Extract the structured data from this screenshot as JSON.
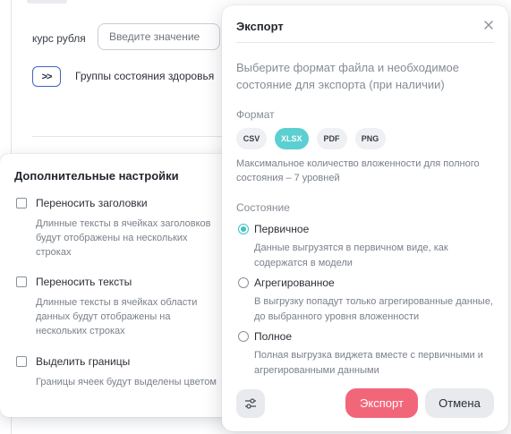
{
  "background": {
    "rate_label": "курс рубля",
    "rate_placeholder": "Введите значение",
    "expand_symbol": ">>",
    "health_groups_label": "Группы состояния здоровья"
  },
  "settings_panel": {
    "title": "Дополнительные настройки",
    "options": [
      {
        "label": "Переносить заголовки",
        "description": "Длинные тексты в ячейках заголовков будут отображены на нескольких строках",
        "checked": false
      },
      {
        "label": "Переносить тексты",
        "description": "Длинные тексты в ячейках области данных будут отображены на нескольких строках",
        "checked": false
      },
      {
        "label": "Выделить границы",
        "description": "Границы ячеек будут выделены цветом",
        "checked": false
      }
    ]
  },
  "export_dialog": {
    "title": "Экспорт",
    "close_icon": "close-icon",
    "intro": "Выберите формат файла и необходимое состояние для экспорта (при наличии)",
    "format_label": "Формат",
    "formats": [
      {
        "label": "CSV",
        "selected": false
      },
      {
        "label": "XLSX",
        "selected": true
      },
      {
        "label": "PDF",
        "selected": false
      },
      {
        "label": "PNG",
        "selected": false
      }
    ],
    "max_nesting_note": "Максимальное количество вложенности для полного состояния – 7 уровней",
    "state_label": "Состояние",
    "states": [
      {
        "label": "Первичное",
        "description": "Данные выгрузятся в первичном виде, как содержатся в модели",
        "selected": true
      },
      {
        "label": "Агрегированное",
        "description": "В выгрузку попадут только агрегированные данные, до выбранного уровня вложенности",
        "selected": false
      },
      {
        "label": "Полное",
        "description": "Полная выгрузка виджета вместе с первичными и агрегированными данными",
        "selected": false
      }
    ],
    "settings_icon": "sliders-icon",
    "export_button": "Экспорт",
    "cancel_button": "Отмена"
  },
  "colors": {
    "accent_teal": "#5ccfd0",
    "export_button": "#f2667a",
    "expand_border": "#3f63c9"
  }
}
